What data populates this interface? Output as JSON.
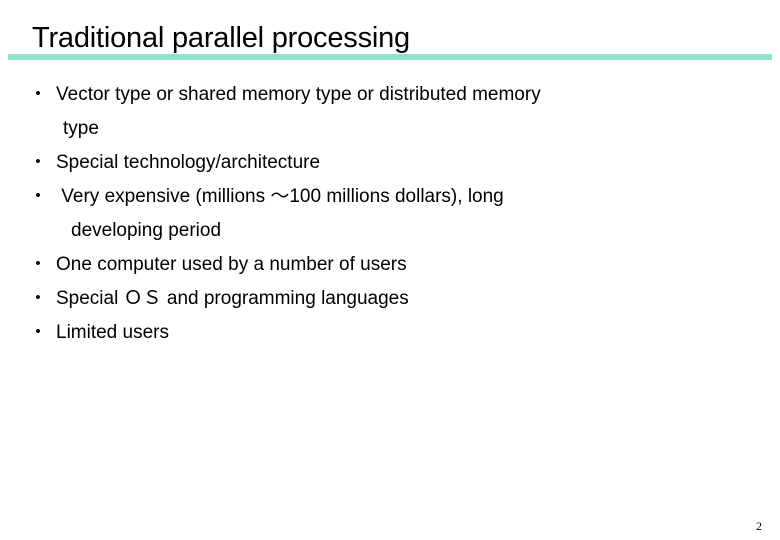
{
  "slide": {
    "title": "Traditional parallel processing",
    "accent_color": "#8ee3cc",
    "bullet_glyph": "・",
    "bullets": [
      {
        "line1": "Vector type or shared memory type or distributed memory",
        "line2": "type"
      },
      {
        "line1": "Special technology/architecture"
      },
      {
        "line1": " Very expensive (millions ～100 millions dollars), long",
        "line2": "developing period"
      },
      {
        "line1": "One computer used by a number of users"
      },
      {
        "line1": "Special ＯＳ and programming languages"
      },
      {
        "line1": "Limited users"
      }
    ],
    "page_number": "2"
  }
}
